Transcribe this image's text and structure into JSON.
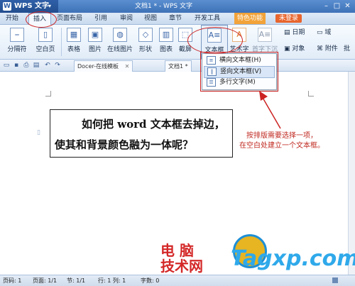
{
  "title_bar": {
    "app_name": "WPS 文字",
    "doc_title": "文档1 * - WPS 文字",
    "logo": "W"
  },
  "menu": {
    "items": [
      "开始",
      "插入",
      "页面布局",
      "引用",
      "审阅",
      "视图",
      "章节",
      "开发工具",
      "特色功能"
    ],
    "login": "未登录"
  },
  "ribbon": {
    "page_break": "分隔符",
    "blank_page": "空白页",
    "table": "表格",
    "picture": "图片",
    "online_picture": "在线图片",
    "shape": "形状",
    "chart": "图表",
    "screenshot": "截屏",
    "textbox": "文本框",
    "wordart": "艺术字",
    "dropcap": "首字下沉",
    "date": "日期",
    "field": "域",
    "object": "对象",
    "attachment": "附件",
    "more": "批"
  },
  "dropdown": {
    "horizontal": "横向文本框(H)",
    "vertical": "竖向文本框(V)",
    "multiline": "多行文字(M)"
  },
  "tabs": {
    "docer": "Docer-在线模板",
    "doc1": "文档1 *"
  },
  "page": {
    "line1": "如何把 word 文本框去掉边，",
    "line2": "使其和背景颜色融为一体呢？"
  },
  "annotation": "按排版需要选择一项，\n在空白处建立一个文本框。",
  "watermark": {
    "cn_line1": "电 脑",
    "cn_line2": "技术网",
    "en": "Tagxp.com"
  },
  "status_bar": {
    "page": "页码: 1",
    "pages": "页面: 1/1",
    "section": "节: 1/1",
    "line_col": "行: 1  列: 1",
    "word_count": "字数: 0"
  },
  "colors": {
    "accent": "#3e72b8",
    "annotation_red": "#cc2222",
    "watermark_blue": "#2fa9ea"
  }
}
